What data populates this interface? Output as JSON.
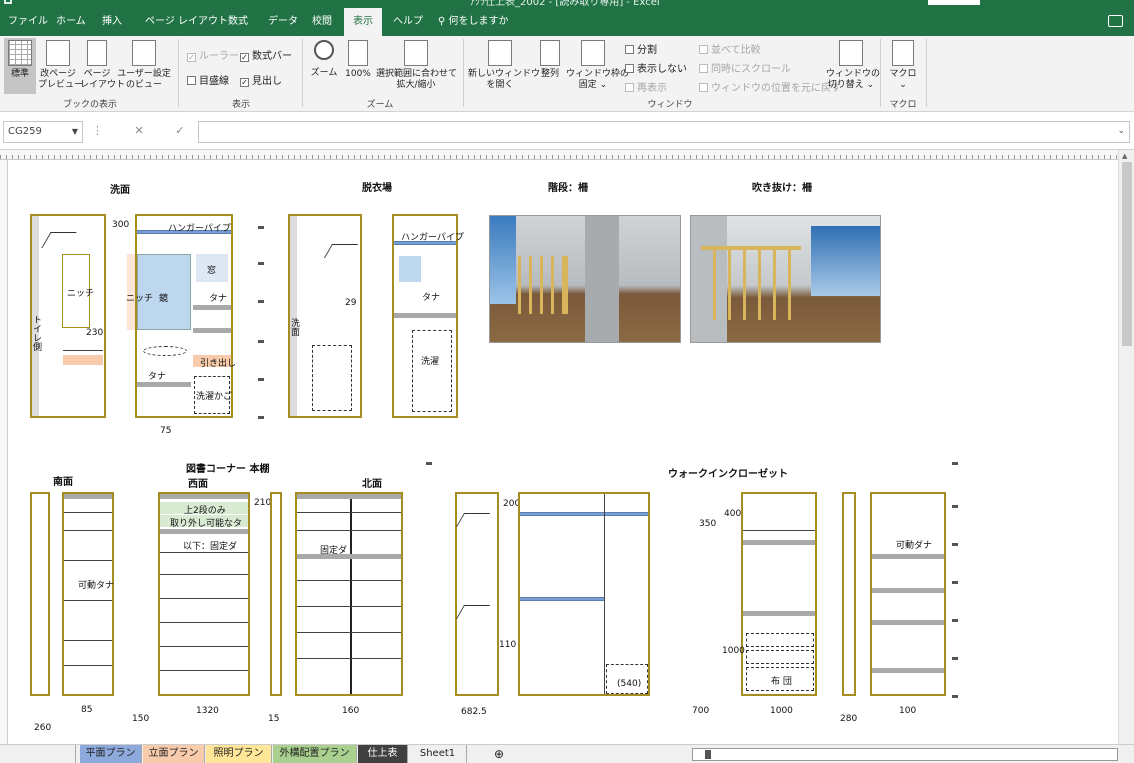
{
  "window": {
    "title": "ｱｸﾗ仕上表_2002 - [読み取り専用] - Excel",
    "sign_in": ""
  },
  "ribbon_tabs": [
    "ファイル",
    "ホーム",
    "挿入",
    "ページ レイアウト",
    "数式",
    "データ",
    "校閲",
    "表示",
    "ヘルプ",
    "何をしますか"
  ],
  "active_tab": "表示",
  "ribbon": {
    "views": {
      "normal": "標準",
      "page_break_1": "改ページ",
      "page_break_2": "プレビュー",
      "page_layout_1": "ページ",
      "page_layout_2": "レイアウト",
      "custom_1": "ユーザー設定",
      "custom_2": "のビュー",
      "group": "ブックの表示"
    },
    "show": {
      "ruler": "ルーラー",
      "formula_bar": "数式バー",
      "gridlines": "目盛線",
      "headings": "見出し",
      "group": "表示"
    },
    "zoom": {
      "zoom": "ズーム",
      "hundred": "100%",
      "fit_1": "選択範囲に合わせて",
      "fit_2": "拡大/縮小",
      "group": "ズーム"
    },
    "window": {
      "new_1": "新しいウィンドウ",
      "new_2": "を開く",
      "arrange": "整列",
      "freeze_1": "ウィンドウ枠の",
      "freeze_2": "固定",
      "split": "分割",
      "hide": "表示しない",
      "unhide": "再表示",
      "side_by_side": "並べて比較",
      "sync_scroll": "同時にスクロール",
      "reset_pos": "ウィンドウの位置を元に戻す",
      "switch_1": "ウィンドウの",
      "switch_2": "切り替え",
      "group": "ウィンドウ"
    },
    "macro": {
      "label": "マクロ",
      "group": "マクロ"
    }
  },
  "formula_bar": {
    "name_box": "CG259",
    "buttons": "⋮ ✕ ✓ fx",
    "content": ""
  },
  "drawings": {
    "section1": {
      "senmen": "洗面",
      "datsuisho": "脱衣場",
      "kaidan": "階段：柵",
      "fukinuke": "吹き抜け：柵",
      "hanger_pipe_1": "ハンガーパイプ",
      "hanger_pipe_2": "ハンガーパイプ",
      "nitchi": "ニッチ",
      "nitchi2": "ニッチ",
      "kagami": "鏡",
      "mado": "窓",
      "tana1": "タナ",
      "tana2": "タナ",
      "tana3": "タナ",
      "hikidashi": "引き出し",
      "sentakukago": "洗濯かご",
      "sentaku": "洗濯",
      "toilet_side": "トイレ側",
      "senmen_side": "洗面",
      "d300": "300",
      "d230": "230",
      "d75": "75",
      "d29": "29"
    },
    "section2": {
      "library_corner": "図書コーナー 本棚",
      "nanmen": "南面",
      "seimen": "西面",
      "hokumen": "北面",
      "walkin": "ウォークインクローゼット",
      "kadou_tana1": "可動タナ",
      "kadou_tana2": "可動ダナ",
      "top2": "上2段のみ",
      "removable": "取り外し可能なタ",
      "below_fixed": "以下：固定ダ",
      "kotei": "固定ダ",
      "futon": "布 団",
      "d200": "200",
      "d110": "110",
      "d210": "210",
      "d350": "350",
      "d400": "400",
      "d1000": "1000",
      "d540": "(540)",
      "d260": "260",
      "d85": "85",
      "d150": "150",
      "d1320": "1320",
      "d15": "15",
      "d160": "160",
      "d682": "682.5",
      "d700": "700",
      "d1000b": "1000",
      "d280": "280",
      "d100": "100"
    }
  },
  "sheet_tabs": [
    {
      "label": "平面プラン",
      "color": "#8ea9db"
    },
    {
      "label": "立面プラン",
      "color": "#f8cbad"
    },
    {
      "label": "照明プラン",
      "color": "#ffe699"
    },
    {
      "label": "外構配置プラン",
      "color": "#a9d08e"
    },
    {
      "label": "仕上表",
      "color": "#404040"
    },
    {
      "label": "Sheet1",
      "color": "#f0f0f0"
    }
  ],
  "colors": {
    "excel_green": "#217346",
    "frame_gold": "#a58d1f"
  }
}
